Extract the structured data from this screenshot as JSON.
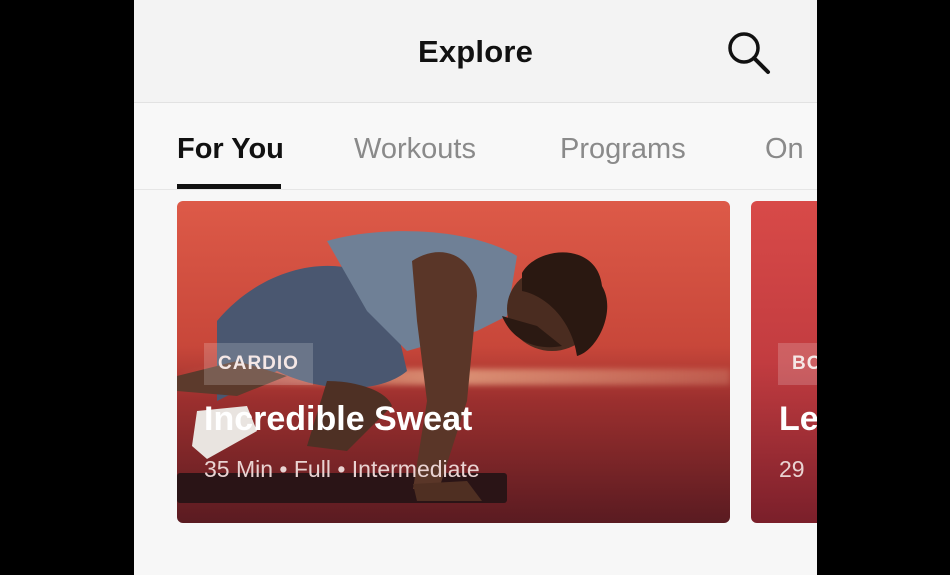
{
  "header": {
    "title": "Explore",
    "search_icon": "search-icon"
  },
  "tabs": [
    {
      "label": "For You",
      "active": true
    },
    {
      "label": "Workouts",
      "active": false
    },
    {
      "label": "Programs",
      "active": false
    },
    {
      "label": "On",
      "active": false
    }
  ],
  "cards": [
    {
      "tag": "CARDIO",
      "title": "Incredible Sweat",
      "meta": "35 Min • Full • Intermediate"
    },
    {
      "tag": "BO",
      "title": "Le",
      "meta": "29"
    }
  ],
  "colors": {
    "active_tab": "#111111",
    "inactive_tab": "#8a8a8a",
    "card_accent": "#dd5a48"
  }
}
